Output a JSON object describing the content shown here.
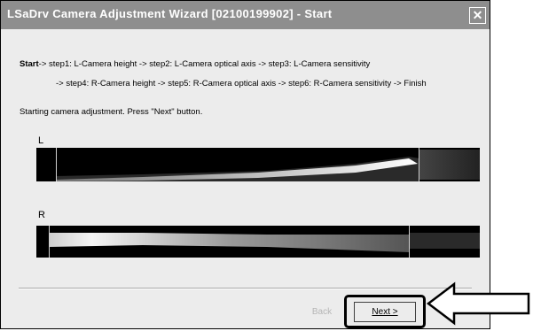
{
  "window": {
    "title": "LSaDrv Camera Adjustment Wizard [02100199902] - Start",
    "close_glyph": "✕"
  },
  "steps": {
    "current": "Start",
    "line1_rest": "-> step1: L-Camera height  -> step2: L-Camera optical axis  -> step3: L-Camera sensitivity",
    "line2": "-> step4: R-Camera height  -> step5: R-Camera optical axis  -> step6: R-Camera sensitivity  -> Finish"
  },
  "instruction": "Starting camera adjustment. Press \"Next\" button.",
  "cameras": {
    "left_label": "L",
    "right_label": "R"
  },
  "buttons": {
    "back_label": "Back",
    "next_label": "Next >"
  },
  "colors": {
    "titlebar": "#8e8e8e",
    "dialog_bg": "#ececec",
    "camera_bg": "#000000"
  },
  "icons": {
    "close": "close-icon",
    "callout": "arrow-left-icon"
  }
}
